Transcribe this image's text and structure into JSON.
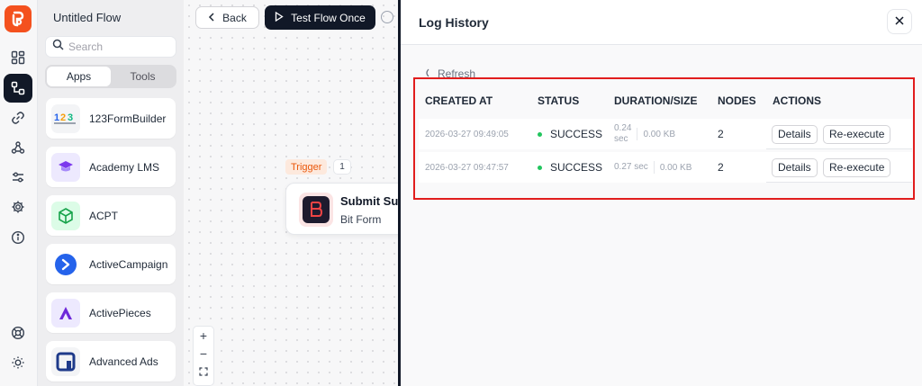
{
  "rail": {
    "icons": [
      "logo-icon",
      "dashboard-icon",
      "flows-icon",
      "link-icon",
      "webhook-icon",
      "settings-sliders-icon",
      "gear-icon",
      "info-icon",
      "support-icon",
      "theme-icon"
    ]
  },
  "sidebar": {
    "title": "Untitled Flow",
    "search_placeholder": "Search",
    "tabs": [
      "Apps",
      "Tools"
    ],
    "apps": [
      {
        "label": "123FormBuilder",
        "icon": "123formbuilder-icon"
      },
      {
        "label": "Academy LMS",
        "icon": "academy-lms-icon"
      },
      {
        "label": "ACPT",
        "icon": "acpt-icon"
      },
      {
        "label": "ActiveCampaign",
        "icon": "activecampaign-icon"
      },
      {
        "label": "ActivePieces",
        "icon": "activepieces-icon"
      },
      {
        "label": "Advanced Ads",
        "icon": "advanced-ads-icon"
      }
    ]
  },
  "canvas": {
    "back_label": "Back",
    "test_label": "Test Flow Once",
    "trigger_label": "Trigger",
    "trigger_count": "1",
    "node_title": "Submit Suc",
    "node_subtitle": "Bit Form",
    "zoom_in": "+",
    "zoom_out": "−"
  },
  "log": {
    "title": "Log History",
    "refresh_label": "Refresh",
    "columns": [
      "CREATED AT",
      "STATUS",
      "DURATION/SIZE",
      "NODES",
      "ACTIONS"
    ],
    "rows": [
      {
        "created_at": "2026-03-27 09:49:05",
        "status": "SUCCESS",
        "duration_line1": "0.24",
        "duration_line2": "sec",
        "size": "0.00 KB",
        "nodes": "2",
        "details": "Details",
        "reexecute": "Re-execute"
      },
      {
        "created_at": "2026-03-27 09:47:57",
        "status": "SUCCESS",
        "duration_line1": "0.27 sec",
        "duration_line2": "",
        "size": "0.00 KB",
        "nodes": "2",
        "details": "Details",
        "reexecute": "Re-execute"
      }
    ]
  },
  "colors": {
    "brand": "#f4511e",
    "dark": "#111827",
    "success": "#22c55e",
    "highlight": "#e11d1d",
    "trigger": "#ea580c"
  }
}
